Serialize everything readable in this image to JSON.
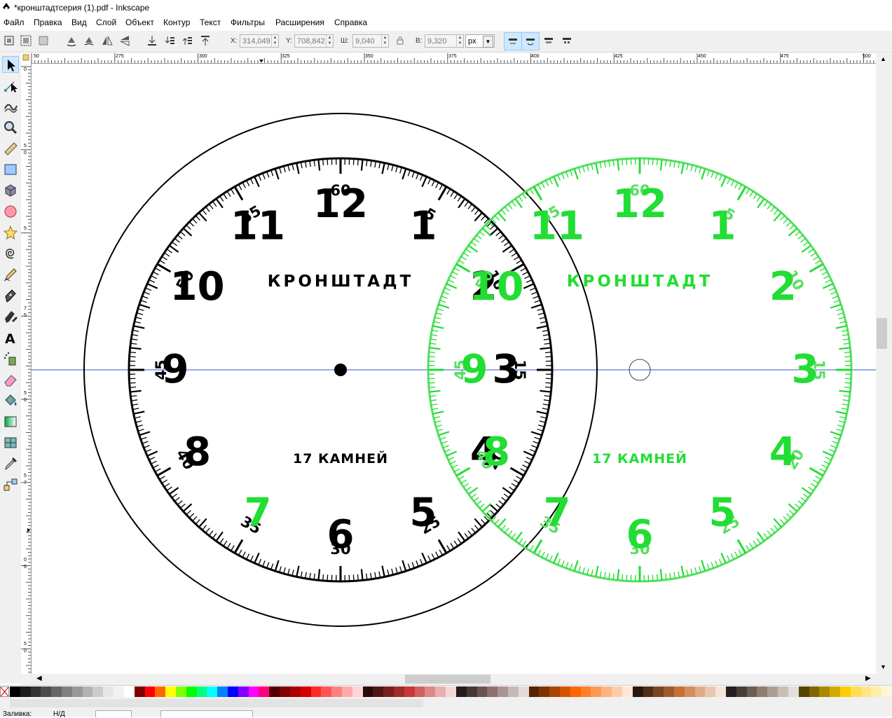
{
  "window": {
    "title": "*кронштадтсерия (1).pdf - Inkscape"
  },
  "menu": [
    "Файл",
    "Правка",
    "Вид",
    "Слой",
    "Объект",
    "Контур",
    "Текст",
    "Фильтры",
    "Расширения",
    "Справка"
  ],
  "toolbar": {
    "x_label": "X:",
    "x_value": "314,049",
    "y_label": "Y:",
    "y_value": "708,842",
    "w_label": "Ш:",
    "w_value": "9,040",
    "h_label": "В:",
    "h_value": "9,320",
    "unit": "px"
  },
  "ruler": {
    "top_ticks": [
      "50",
      "275",
      "300",
      "325",
      "350",
      "375",
      "400",
      "425",
      "450",
      "475",
      "500"
    ],
    "left_ticks": [
      "0",
      "5",
      "0",
      "5",
      "7",
      "5",
      "5",
      "0",
      "5",
      "7",
      "0",
      "6",
      "5",
      "0",
      "7",
      "0",
      "6",
      "7",
      "5"
    ]
  },
  "dial_black": {
    "brand": "КРОНШТАДТ",
    "jewels": "17 КАМНЕЙ",
    "hours": [
      "12",
      "1",
      "2",
      "3",
      "4",
      "5",
      "6",
      "7",
      "8",
      "9",
      "10",
      "11"
    ],
    "minutes": [
      "60",
      "5",
      "10",
      "15",
      "20",
      "25",
      "30",
      "35",
      "40",
      "45",
      "50",
      "55"
    ]
  },
  "dial_green": {
    "brand": "КРОНШТАДТ",
    "jewels": "17 КАМНЕЙ",
    "hours": [
      "12",
      "1",
      "2",
      "3",
      "4",
      "5",
      "6",
      "7",
      "8",
      "9",
      "10",
      "11"
    ],
    "minutes": [
      "60",
      "5",
      "10",
      "15",
      "20",
      "25",
      "30",
      "35",
      "40",
      "45",
      "50",
      "55"
    ]
  },
  "colors": {
    "accent_green": "#22dd33",
    "green_light": "#55e060",
    "guide": "#3355cc"
  },
  "palette": [
    "#000000",
    "#1a1a1a",
    "#333333",
    "#4d4d4d",
    "#666666",
    "#808080",
    "#999999",
    "#b3b3b3",
    "#cccccc",
    "#e6e6e6",
    "#f2f2f2",
    "#ffffff",
    "#800000",
    "#ff0000",
    "#ff6600",
    "#ffff00",
    "#80ff00",
    "#00ff00",
    "#00ff80",
    "#00ffff",
    "#0080ff",
    "#0000ff",
    "#8000ff",
    "#ff00ff",
    "#ff0080",
    "#550000",
    "#800000",
    "#aa0000",
    "#d40000",
    "#ff2a2a",
    "#ff5555",
    "#ff8080",
    "#ffaaaa",
    "#ffd5d5",
    "#280b0b",
    "#501616",
    "#782121",
    "#a02c2c",
    "#c83737",
    "#d35f5f",
    "#de8787",
    "#e9afaf",
    "#f4d7d7",
    "#241c1c",
    "#483737",
    "#6c5353",
    "#916f6f",
    "#ac9393",
    "#c8b7b7",
    "#e3dbdb",
    "#552200",
    "#803300",
    "#aa4400",
    "#d45500",
    "#ff6600",
    "#ff7f2a",
    "#ff9955",
    "#ffb380",
    "#ffccaa",
    "#ffe6d5",
    "#28170b",
    "#502d16",
    "#784421",
    "#a05a2c",
    "#c87137",
    "#d38d5f",
    "#deaa87",
    "#e9c6af",
    "#f4e3d7",
    "#241f1c",
    "#483e37",
    "#6c5d53",
    "#917c6f",
    "#ac9d93",
    "#c8beb7",
    "#e3dedb",
    "#554400",
    "#806600",
    "#aa8800",
    "#d4aa00",
    "#ffcc00",
    "#ffdd55",
    "#ffe680",
    "#ffeeaa",
    "#fff6d5"
  ],
  "status": {
    "fill_label": "Заливка:",
    "fill_value": "Н/Д"
  }
}
